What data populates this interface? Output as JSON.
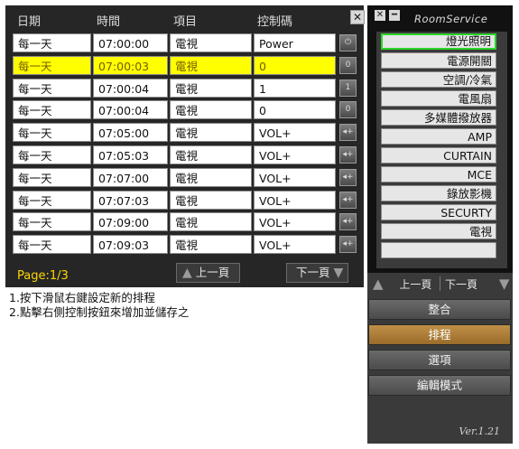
{
  "schedule": {
    "headers": [
      "日期",
      "時間",
      "項目",
      "控制碼"
    ],
    "rows": [
      {
        "day": "每一天",
        "time": "07:00:00",
        "item": "電視",
        "code": "Power",
        "icon": "power-icon",
        "glyph": "⏻"
      },
      {
        "day": "每一天",
        "time": "07:00:03",
        "item": "電視",
        "code": "0",
        "icon": "digit-0-icon",
        "glyph": "0",
        "highlighted": true
      },
      {
        "day": "每一天",
        "time": "07:00:04",
        "item": "電視",
        "code": "1",
        "icon": "digit-1-icon",
        "glyph": "1"
      },
      {
        "day": "每一天",
        "time": "07:00:04",
        "item": "電視",
        "code": "0",
        "icon": "digit-0-icon",
        "glyph": "0"
      },
      {
        "day": "每一天",
        "time": "07:05:00",
        "item": "電視",
        "code": "VOL+",
        "icon": "volume-up-icon",
        "glyph": "◂+"
      },
      {
        "day": "每一天",
        "time": "07:05:03",
        "item": "電視",
        "code": "VOL+",
        "icon": "volume-up-icon",
        "glyph": "◂+"
      },
      {
        "day": "每一天",
        "time": "07:07:00",
        "item": "電視",
        "code": "VOL+",
        "icon": "volume-up-icon",
        "glyph": "◂+"
      },
      {
        "day": "每一天",
        "time": "07:07:03",
        "item": "電視",
        "code": "VOL+",
        "icon": "volume-up-icon",
        "glyph": "◂+"
      },
      {
        "day": "每一天",
        "time": "07:09:00",
        "item": "電視",
        "code": "VOL+",
        "icon": "volume-up-icon",
        "glyph": "◂+"
      },
      {
        "day": "每一天",
        "time": "07:09:03",
        "item": "電視",
        "code": "VOL+",
        "icon": "volume-up-icon",
        "glyph": "◂+"
      }
    ],
    "page_info": "Page:1/3",
    "prev_label": "上一頁",
    "next_label": "下一頁",
    "close_glyph": "✕"
  },
  "help": {
    "line1": "1.按下滑鼠右鍵設定新的排程",
    "line2": "2.點擊右側控制按鈕來增加並儲存之"
  },
  "room_service": {
    "title": "RoomService",
    "close_glyph": "✕",
    "minimize_glyph": "━",
    "devices": [
      "燈光照明",
      "電源開關",
      "空調/冷氣",
      "電風扇",
      "多媒體撥放器",
      "AMP",
      "CURTAIN",
      "MCE",
      "錄放影機",
      "SECURTY",
      "電視",
      ""
    ],
    "selected_device_index": 0,
    "prev_label": "上一頁",
    "next_label": "下一頁",
    "menu": [
      {
        "label": "整合",
        "active": false
      },
      {
        "label": "排程",
        "active": true
      },
      {
        "label": "選項",
        "active": false
      },
      {
        "label": "編輯模式",
        "active": false
      }
    ],
    "version": "Ver.1.21"
  },
  "colors": {
    "panel_bg": "#262626",
    "highlight_row": "#ffff00",
    "page_info_text": "#ffd700",
    "selected_device_border": "#2bd42b",
    "active_menu": "#b4823c"
  }
}
